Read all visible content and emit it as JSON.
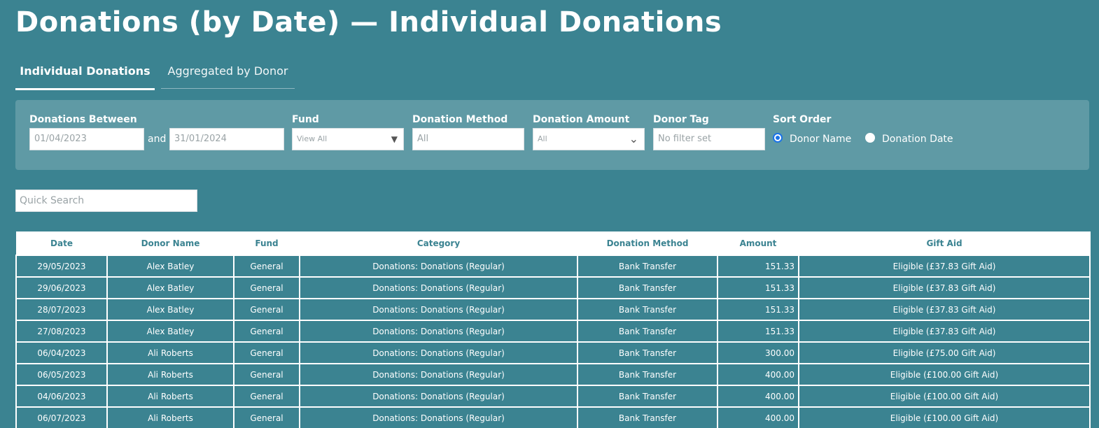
{
  "page": {
    "title": "Donations (by Date) — Individual Donations"
  },
  "tabs": [
    {
      "label": "Individual Donations",
      "active": true
    },
    {
      "label": "Aggregated by Donor",
      "active": false
    }
  ],
  "filters": {
    "donations_between": {
      "label": "Donations Between",
      "from": "01/04/2023",
      "and_label": "and",
      "to": "31/01/2024"
    },
    "fund": {
      "label": "Fund",
      "value": "View All"
    },
    "donation_method": {
      "label": "Donation Method",
      "value": "All"
    },
    "donation_amount": {
      "label": "Donation Amount",
      "value": "All"
    },
    "donor_tag": {
      "label": "Donor Tag",
      "value": "No filter set"
    },
    "sort_order": {
      "label": "Sort Order",
      "options": [
        {
          "label": "Donor Name",
          "selected": true
        },
        {
          "label": "Donation Date",
          "selected": false
        }
      ]
    }
  },
  "search": {
    "placeholder": "Quick Search"
  },
  "table": {
    "columns": [
      "Date",
      "Donor Name",
      "Fund",
      "Category",
      "Donation Method",
      "Amount",
      "Gift Aid"
    ],
    "rows": [
      [
        "29/05/2023",
        "Alex Batley",
        "General",
        "Donations: Donations (Regular)",
        "Bank Transfer",
        "151.33",
        "Eligible (£37.83 Gift Aid)"
      ],
      [
        "29/06/2023",
        "Alex Batley",
        "General",
        "Donations: Donations (Regular)",
        "Bank Transfer",
        "151.33",
        "Eligible (£37.83 Gift Aid)"
      ],
      [
        "28/07/2023",
        "Alex Batley",
        "General",
        "Donations: Donations (Regular)",
        "Bank Transfer",
        "151.33",
        "Eligible (£37.83 Gift Aid)"
      ],
      [
        "27/08/2023",
        "Alex Batley",
        "General",
        "Donations: Donations (Regular)",
        "Bank Transfer",
        "151.33",
        "Eligible (£37.83 Gift Aid)"
      ],
      [
        "06/04/2023",
        "Ali Roberts",
        "General",
        "Donations: Donations (Regular)",
        "Bank Transfer",
        "300.00",
        "Eligible (£75.00 Gift Aid)"
      ],
      [
        "06/05/2023",
        "Ali Roberts",
        "General",
        "Donations: Donations (Regular)",
        "Bank Transfer",
        "400.00",
        "Eligible (£100.00 Gift Aid)"
      ],
      [
        "04/06/2023",
        "Ali Roberts",
        "General",
        "Donations: Donations (Regular)",
        "Bank Transfer",
        "400.00",
        "Eligible (£100.00 Gift Aid)"
      ],
      [
        "06/07/2023",
        "Ali Roberts",
        "General",
        "Donations: Donations (Regular)",
        "Bank Transfer",
        "400.00",
        "Eligible (£100.00 Gift Aid)"
      ]
    ]
  },
  "colors": {
    "background": "#3b8391",
    "filter_panel": "#5f9aa5",
    "header_text": "#3b8391",
    "radio_selected": "#1a73e8"
  }
}
